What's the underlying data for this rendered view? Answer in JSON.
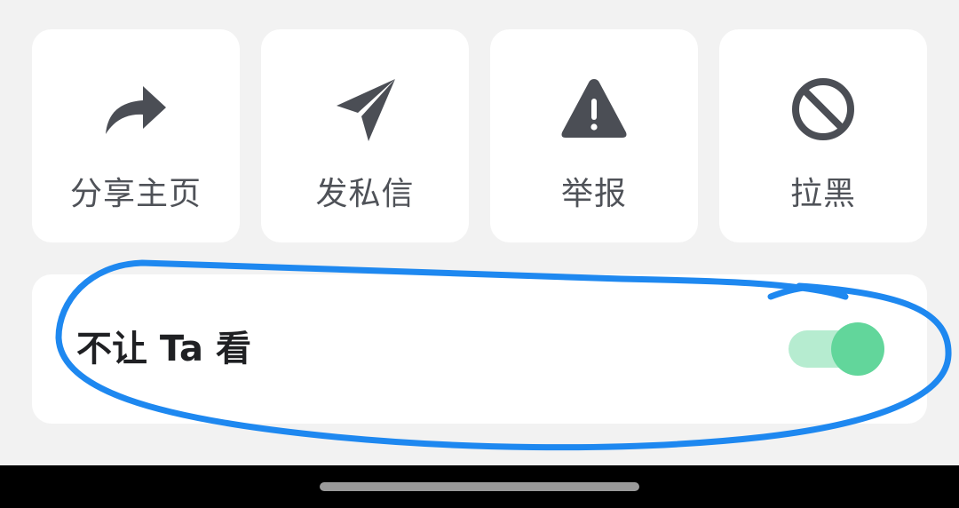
{
  "actions": [
    {
      "label": "分享主页",
      "icon": "share-icon"
    },
    {
      "label": "发私信",
      "icon": "send-message-icon"
    },
    {
      "label": "举报",
      "icon": "warning-icon"
    },
    {
      "label": "拉黑",
      "icon": "block-icon"
    }
  ],
  "privacy": {
    "label": "不让 Ta 看"
  },
  "toggle": {
    "on": true,
    "colors": {
      "track_on": "#b6ecd0",
      "knob_on": "#62d69b"
    }
  },
  "colors": {
    "background": "#f2f2f2",
    "card": "#ffffff",
    "icon": "#4b4e55",
    "label": "#4f5258",
    "annotation": "#1e88f0"
  },
  "system": {
    "nav_bar_icon": "home-indicator"
  }
}
